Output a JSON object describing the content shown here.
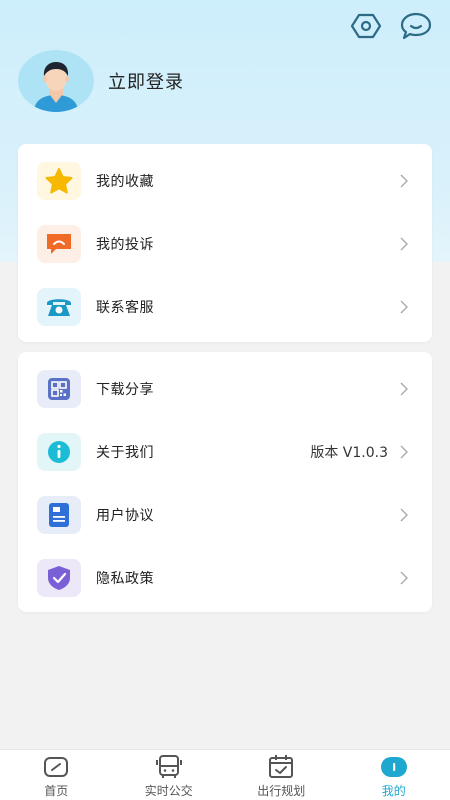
{
  "header": {
    "icons": [
      "settings-icon",
      "message-icon"
    ],
    "login_text": "立即登录"
  },
  "menu_group_1": [
    {
      "label": "我的收藏",
      "icon": "star-icon",
      "icon_bg": "#fff7e0",
      "icon_color": "#f6b200"
    },
    {
      "label": "我的投诉",
      "icon": "complaint-icon",
      "icon_bg": "#fdeee6",
      "icon_color": "#f06a28"
    },
    {
      "label": "联系客服",
      "icon": "phone-icon",
      "icon_bg": "#e3f5fa",
      "icon_color": "#1a98c6"
    }
  ],
  "menu_group_2": [
    {
      "label": "下载分享",
      "icon": "qrcode-icon",
      "icon_bg": "#e8ecf8",
      "icon_color": "#5a72c6",
      "value": ""
    },
    {
      "label": "关于我们",
      "icon": "info-icon",
      "icon_bg": "#e2f6f8",
      "icon_color": "#1bbcd6",
      "value": "版本 V1.0.3"
    },
    {
      "label": "用户协议",
      "icon": "document-icon",
      "icon_bg": "#e6ecf8",
      "icon_color": "#2f6fd8",
      "value": ""
    },
    {
      "label": "隐私政策",
      "icon": "shield-icon",
      "icon_bg": "#ece8f8",
      "icon_color": "#7a5fd6",
      "value": ""
    }
  ],
  "tabbar": [
    {
      "label": "首页",
      "icon": "home-icon",
      "active": false
    },
    {
      "label": "实时公交",
      "icon": "bus-icon",
      "active": false
    },
    {
      "label": "出行规划",
      "icon": "calendar-icon",
      "active": false
    },
    {
      "label": "我的",
      "icon": "profile-icon",
      "active": true
    }
  ],
  "colors": {
    "accent": "#1fa8cf",
    "page_bg": "#f2f2f2",
    "header_bg": "#cdeefb"
  }
}
